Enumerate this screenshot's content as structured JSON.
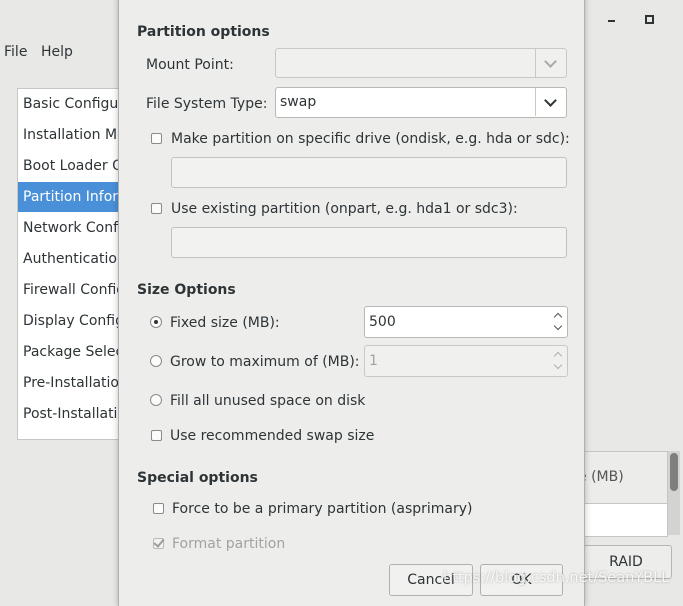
{
  "main_window": {
    "menu": [
      "File",
      "Help"
    ],
    "sidebar_items": [
      {
        "label": "Basic Configuration",
        "selected": false
      },
      {
        "label": "Installation Method",
        "selected": false
      },
      {
        "label": "Boot Loader Options",
        "selected": false
      },
      {
        "label": "Partition Information",
        "selected": true
      },
      {
        "label": "Network Configuration",
        "selected": false
      },
      {
        "label": "Authentication",
        "selected": false
      },
      {
        "label": "Firewall Configuration",
        "selected": false
      },
      {
        "label": "Display Configuration",
        "selected": false
      },
      {
        "label": "Package Selection",
        "selected": false
      },
      {
        "label": "Pre-Installation Script",
        "selected": false
      },
      {
        "label": "Post-Installation Script",
        "selected": false
      }
    ],
    "table_header_fragment": "e (MB)",
    "raid_button": "RAID",
    "selection_color": "#4a90d9"
  },
  "dialog": {
    "partition_options_heading": "Partition options",
    "mount_point_label": "Mount Point:",
    "mount_point_value": "",
    "fs_type_label": "File System Type:",
    "fs_type_value": "swap",
    "ondisk_label": "Make partition on specific drive (ondisk, e.g. hda or sdc):",
    "ondisk_value": "",
    "onpart_label": "Use existing partition (onpart, e.g. hda1 or sdc3):",
    "onpart_value": "",
    "size_options_heading": "Size Options",
    "fixed_size_label": "Fixed size (MB):",
    "fixed_size_value": "500",
    "grow_label": "Grow to maximum of (MB):",
    "grow_value": "1",
    "fill_label": "Fill all unused space on disk",
    "recommended_swap_label": "Use recommended swap size",
    "special_options_heading": "Special options",
    "primary_label": "Force to be a primary partition (asprimary)",
    "format_label": "Format partition",
    "cancel_button": "Cancel",
    "ok_button": "OK"
  },
  "watermark": "https://blog.csdn.net/SeanYBLL"
}
